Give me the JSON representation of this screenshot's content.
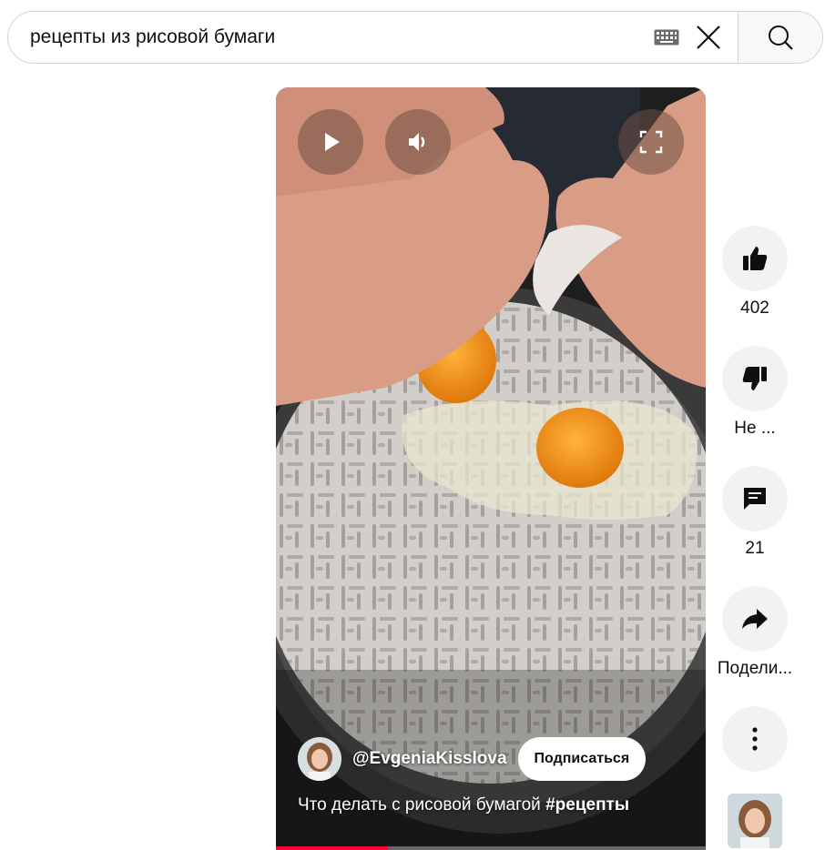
{
  "search": {
    "query": "рецепты из рисовой бумаги"
  },
  "video": {
    "channel_handle": "@EvgeniaKisslova",
    "subscribe_label": "Подписаться",
    "title_text": "Что делать с рисовой бумагой ",
    "title_hashtag": "#рецепты",
    "progress_fraction": 0.26,
    "progress_color": "#ff0033"
  },
  "controls": {
    "play_icon": "play-icon",
    "volume_icon": "volume-icon",
    "fullscreen_icon": "fullscreen-icon"
  },
  "actions": {
    "like_count": "402",
    "dislike_label": "Не ...",
    "comments_count": "21",
    "share_label": "Подели..."
  }
}
